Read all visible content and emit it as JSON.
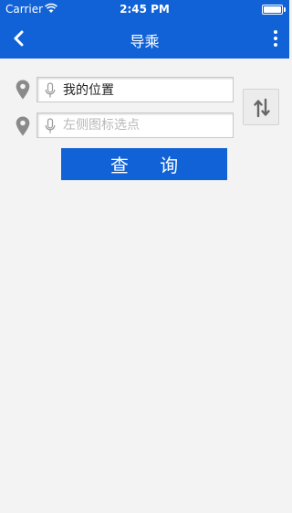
{
  "status_bar": {
    "carrier": "Carrier",
    "time": "2:45 PM"
  },
  "nav": {
    "title": "导乘",
    "back_icon": "chevron-left-icon",
    "more_icon": "more-vertical-icon",
    "background_color": "#1162d6"
  },
  "route": {
    "start": {
      "value": "我的位置",
      "placeholder": ""
    },
    "end": {
      "value": "",
      "placeholder": "左侧图标选点"
    },
    "swap_icon": "swap-vertical-icon"
  },
  "query_button": {
    "label": "查 询",
    "color": "#1162d6"
  }
}
